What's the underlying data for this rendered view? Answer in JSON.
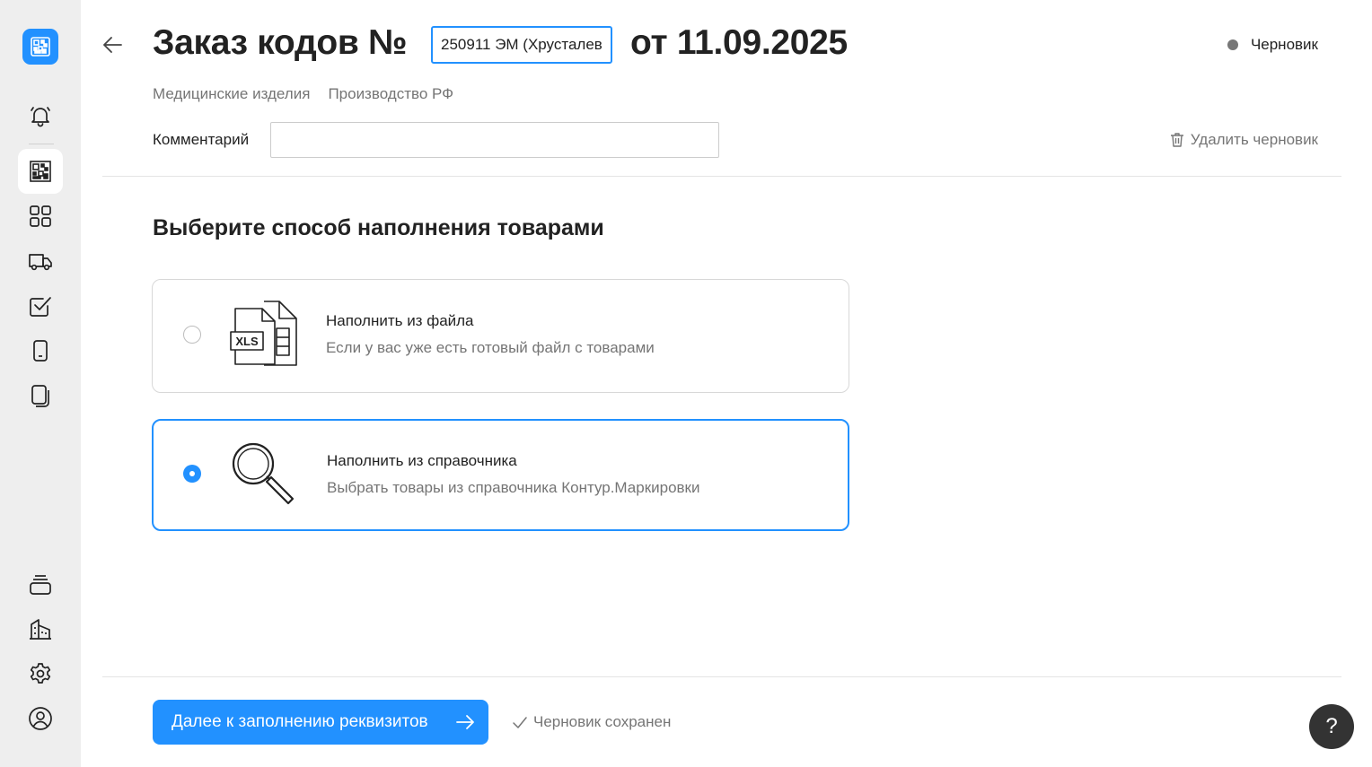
{
  "header": {
    "title": "Заказ кодов №",
    "order_number_value": "250911 ЭМ (Хрусталев",
    "date_text": "от 11.09.2025",
    "status": "Черновик",
    "status_color": "#777777",
    "tags": [
      "Медицинские изделия",
      "Производство РФ"
    ]
  },
  "comment": {
    "label": "Комментарий",
    "value": "",
    "placeholder": ""
  },
  "delete_draft_label": "Удалить черновик",
  "section_title": "Выберите способ наполнения товарами",
  "options": [
    {
      "title": "Наполнить из файла",
      "description": "Если у вас уже есть готовый файл с товарами",
      "icon": "xls-file-icon",
      "icon_text": "XLS",
      "selected": false
    },
    {
      "title": "Наполнить из справочника",
      "description": "Выбрать товары из справочника Контур.Маркировки",
      "icon": "magnifier-icon",
      "selected": true
    }
  ],
  "footer": {
    "next_button_label": "Далее к заполнению реквизитов",
    "saved_status": "Черновик сохранен"
  },
  "help_label": "?",
  "sidebar": {
    "items": [
      {
        "icon": "bell-icon"
      },
      {
        "icon": "datamatrix-icon",
        "active": true
      },
      {
        "icon": "grid-icon"
      },
      {
        "icon": "truck-icon"
      },
      {
        "icon": "checkbox-icon"
      },
      {
        "icon": "device-icon"
      },
      {
        "icon": "documents-icon"
      },
      {
        "icon": "stack-icon"
      },
      {
        "icon": "building-icon"
      },
      {
        "icon": "gear-icon"
      },
      {
        "icon": "user-icon"
      }
    ]
  },
  "colors": {
    "accent": "#2291ff",
    "sidebar_bg": "#eeeeee",
    "help_bg": "#333333"
  }
}
